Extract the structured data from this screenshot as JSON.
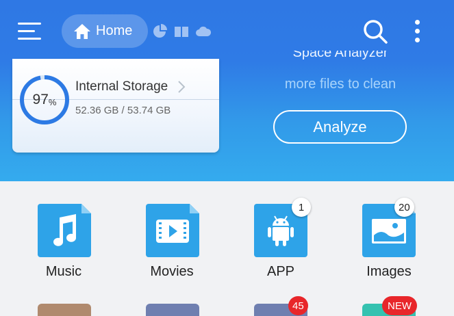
{
  "appbar": {
    "home_label": "Home",
    "icons": [
      "menu-icon",
      "home-icon",
      "pie-chart-icon",
      "book-icon",
      "cloud-icon",
      "search-icon",
      "more-vertical-icon"
    ]
  },
  "storage_card": {
    "percent": "97",
    "percent_sign": "%",
    "title": "Internal Storage",
    "usage": "52.36 GB / 53.74 GB",
    "used_fraction": 0.97
  },
  "analyzer": {
    "title": "Space Analyzer",
    "subtitle": "more files to clean",
    "button_label": "Analyze"
  },
  "categories": [
    {
      "label": "Music",
      "icon": "music-icon",
      "badge": ""
    },
    {
      "label": "Movies",
      "icon": "movie-icon",
      "badge": ""
    },
    {
      "label": "APP",
      "icon": "android-icon",
      "badge": "1"
    },
    {
      "label": "Images",
      "icon": "image-icon",
      "badge": "20"
    }
  ],
  "second_row": [
    {
      "badge": "",
      "color": "#b08a6e"
    },
    {
      "badge": "",
      "color": "#6f7fb0"
    },
    {
      "badge": "45",
      "color": "#6f7fb0"
    },
    {
      "badge": "NEW",
      "color": "#35c2b0"
    }
  ],
  "colors": {
    "primary": "#2f7be6",
    "tile_blue": "#2ea3e8",
    "badge_red": "#e8262a"
  }
}
